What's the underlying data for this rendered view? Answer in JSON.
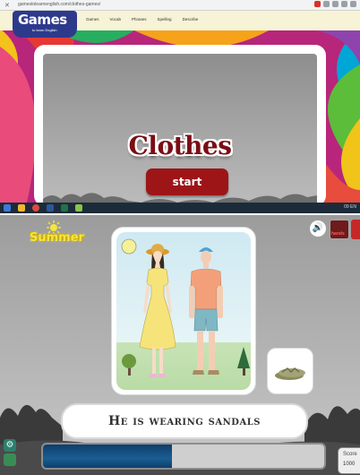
{
  "browser": {
    "url": "gamestolearnenglish.com/clothes-games/",
    "close_glyph": "✕"
  },
  "site": {
    "logo_title_main": "Games",
    "logo_subtitle": "to learn English",
    "nav": [
      "Games",
      "Vocab",
      "Phrases",
      "Spelling",
      "Describe"
    ]
  },
  "start_screen": {
    "title": "Clothes",
    "start_label": "start"
  },
  "taskbar": {
    "tray_text": "09 EN"
  },
  "game": {
    "theme_label": "Summer",
    "speaker_glyph": "🔊",
    "side_button_label": "hands",
    "sentence": "He is wearing sandals",
    "progress_fraction": 0.46,
    "score_label": "Score",
    "score_value": "1000",
    "gear_glyph": "⚙"
  },
  "colors": {
    "title_red": "#7a0d14",
    "start_button": "#9e1518",
    "progress_fill": "#1b5e93",
    "summer_yellow": "#f7e53c"
  }
}
